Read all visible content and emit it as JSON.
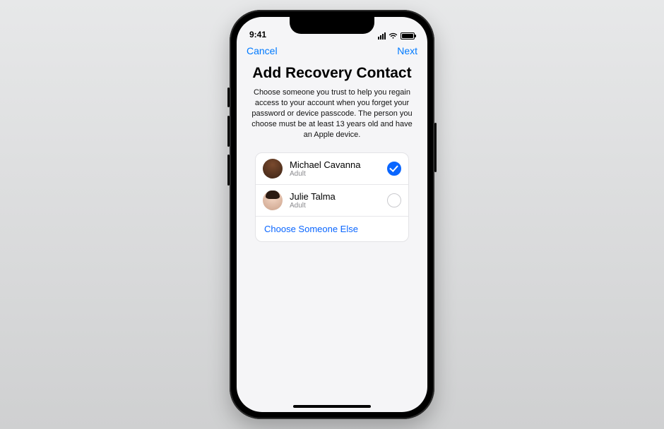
{
  "status": {
    "time": "9:41"
  },
  "nav": {
    "cancel": "Cancel",
    "next": "Next"
  },
  "page": {
    "title": "Add Recovery Contact",
    "description": "Choose someone you trust to help you regain access to your account when you forget your password or device passcode. The person you choose must be at least 13 years old and have an Apple device."
  },
  "contacts": [
    {
      "name": "Michael Cavanna",
      "role": "Adult",
      "selected": true
    },
    {
      "name": "Julie Talma",
      "role": "Adult",
      "selected": false
    }
  ],
  "choose_else": "Choose Someone Else"
}
